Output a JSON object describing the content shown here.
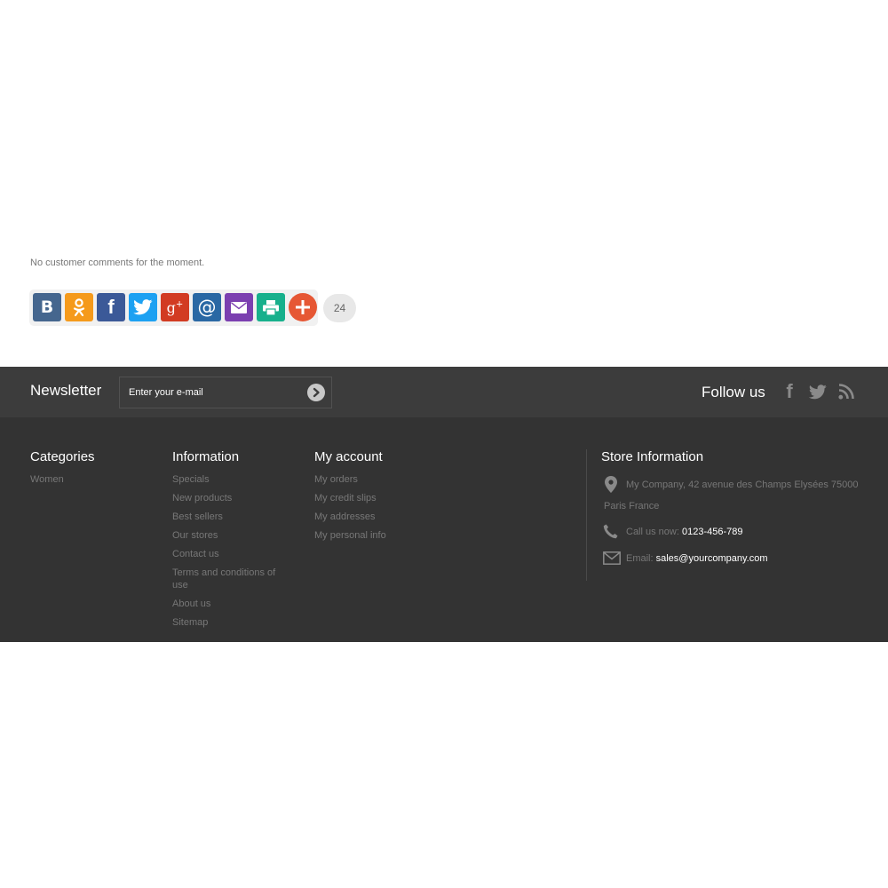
{
  "comments": {
    "empty_text": "No customer comments for the moment."
  },
  "share": {
    "buttons": [
      {
        "name": "vkontakte-button",
        "glyph": "B",
        "color": "#45668e",
        "icon": "vkontakte-icon"
      },
      {
        "name": "odnoklassniki-button",
        "glyph": "ok",
        "color": "#f59a1b",
        "icon": "odnoklassniki-icon"
      },
      {
        "name": "facebook-button",
        "glyph": "f",
        "color": "#3b5998",
        "icon": "facebook-icon"
      },
      {
        "name": "twitter-button",
        "glyph": "tw",
        "color": "#1da1f2",
        "icon": "twitter-icon"
      },
      {
        "name": "googleplus-button",
        "glyph": "g+",
        "color": "#d23b22",
        "icon": "googleplus-icon"
      },
      {
        "name": "mailru-button",
        "glyph": "@",
        "color": "#2a68a4",
        "icon": "at-icon"
      },
      {
        "name": "email-button",
        "glyph": "mail",
        "color": "#7b3fb0",
        "icon": "envelope-icon"
      },
      {
        "name": "print-button",
        "glyph": "print",
        "color": "#17b08c",
        "icon": "printer-icon"
      },
      {
        "name": "more-button",
        "glyph": "+",
        "color": "#e65734",
        "icon": "plus-icon"
      }
    ],
    "count": "24"
  },
  "newsletter": {
    "title": "Newsletter",
    "placeholder": "Enter your e-mail",
    "submit_icon": "arrow-right-circle-icon"
  },
  "follow": {
    "title": "Follow us",
    "icons": [
      "facebook-icon",
      "twitter-icon",
      "rss-icon"
    ]
  },
  "footer": {
    "categories": {
      "title": "Categories",
      "items": [
        "Women"
      ]
    },
    "information": {
      "title": "Information",
      "items": [
        "Specials",
        "New products",
        "Best sellers",
        "Our stores",
        "Contact us",
        "Terms and conditions of use",
        "About us",
        "Sitemap"
      ]
    },
    "account": {
      "title": "My account",
      "items": [
        "My orders",
        "My credit slips",
        "My addresses",
        "My personal info"
      ]
    },
    "store": {
      "title": "Store Information",
      "address_line1": "My Company, 42 avenue des Champs Elysées 75000",
      "address_line2": "Paris France",
      "phone_label": "Call us now:",
      "phone_value": "0123-456-789",
      "email_label": "Email:",
      "email_value": "sales@yourcompany.com"
    }
  },
  "colors": {
    "newsletter_bg": "#3c3c3c",
    "footer_bg": "#333333",
    "link_muted": "#777777"
  }
}
